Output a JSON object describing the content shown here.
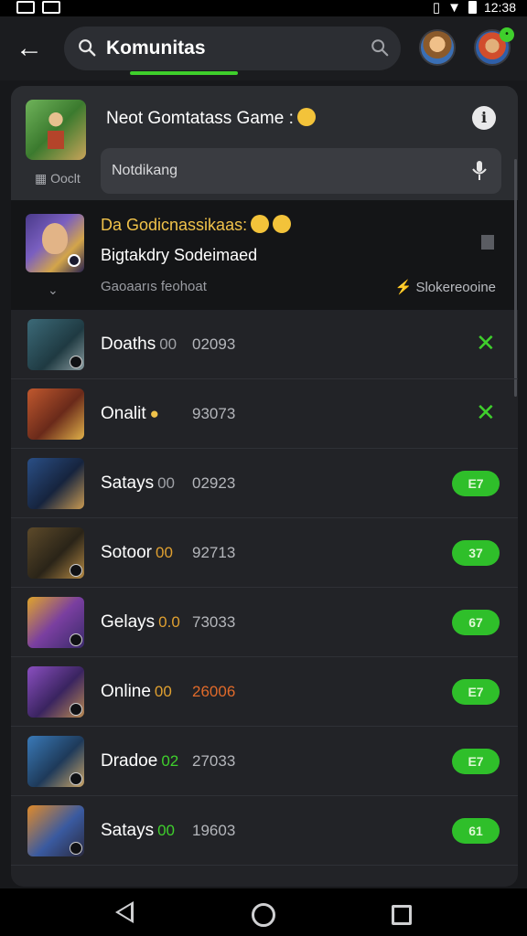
{
  "status_bar": {
    "time": "12:38"
  },
  "top_bar": {
    "search_value": "Komunitas"
  },
  "header": {
    "title": "Neot Gomtatass Game :",
    "tag": "Ooclt",
    "info_label": "i",
    "notif_value": "Notdikang"
  },
  "featured": {
    "title": "Da Godicnassikaas:",
    "subtitle": "Bigtakdry Sodeimaed",
    "meta": "Gaoaarıs feohoat",
    "right_label": "Slokereooine"
  },
  "rows": [
    {
      "name": "Doaths",
      "tag": "00",
      "number": "02093",
      "action": "x",
      "pill": ""
    },
    {
      "name": "Onalit",
      "tag": "",
      "number": "93073",
      "action": "x",
      "pill": ""
    },
    {
      "name": "Satays",
      "tag": "00",
      "number": "02923",
      "action": "pill",
      "pill": "E7"
    },
    {
      "name": "Sotoor",
      "tag": "00",
      "number": "92713",
      "action": "pill",
      "pill": "37"
    },
    {
      "name": "Gelays",
      "tag": "0.0",
      "number": "73033",
      "action": "pill",
      "pill": "67"
    },
    {
      "name": "Online",
      "tag": "00",
      "number": "26006",
      "action": "pill",
      "pill": "E7"
    },
    {
      "name": "Dradoe",
      "tag": "02",
      "number": "27033",
      "action": "pill",
      "pill": "E7"
    },
    {
      "name": "Satays",
      "tag": "00",
      "number": "19603",
      "action": "pill",
      "pill": "61"
    }
  ],
  "colors": {
    "accent_green": "#3fcf2c",
    "featured_title": "#f0c24a",
    "background": "#17181b"
  }
}
